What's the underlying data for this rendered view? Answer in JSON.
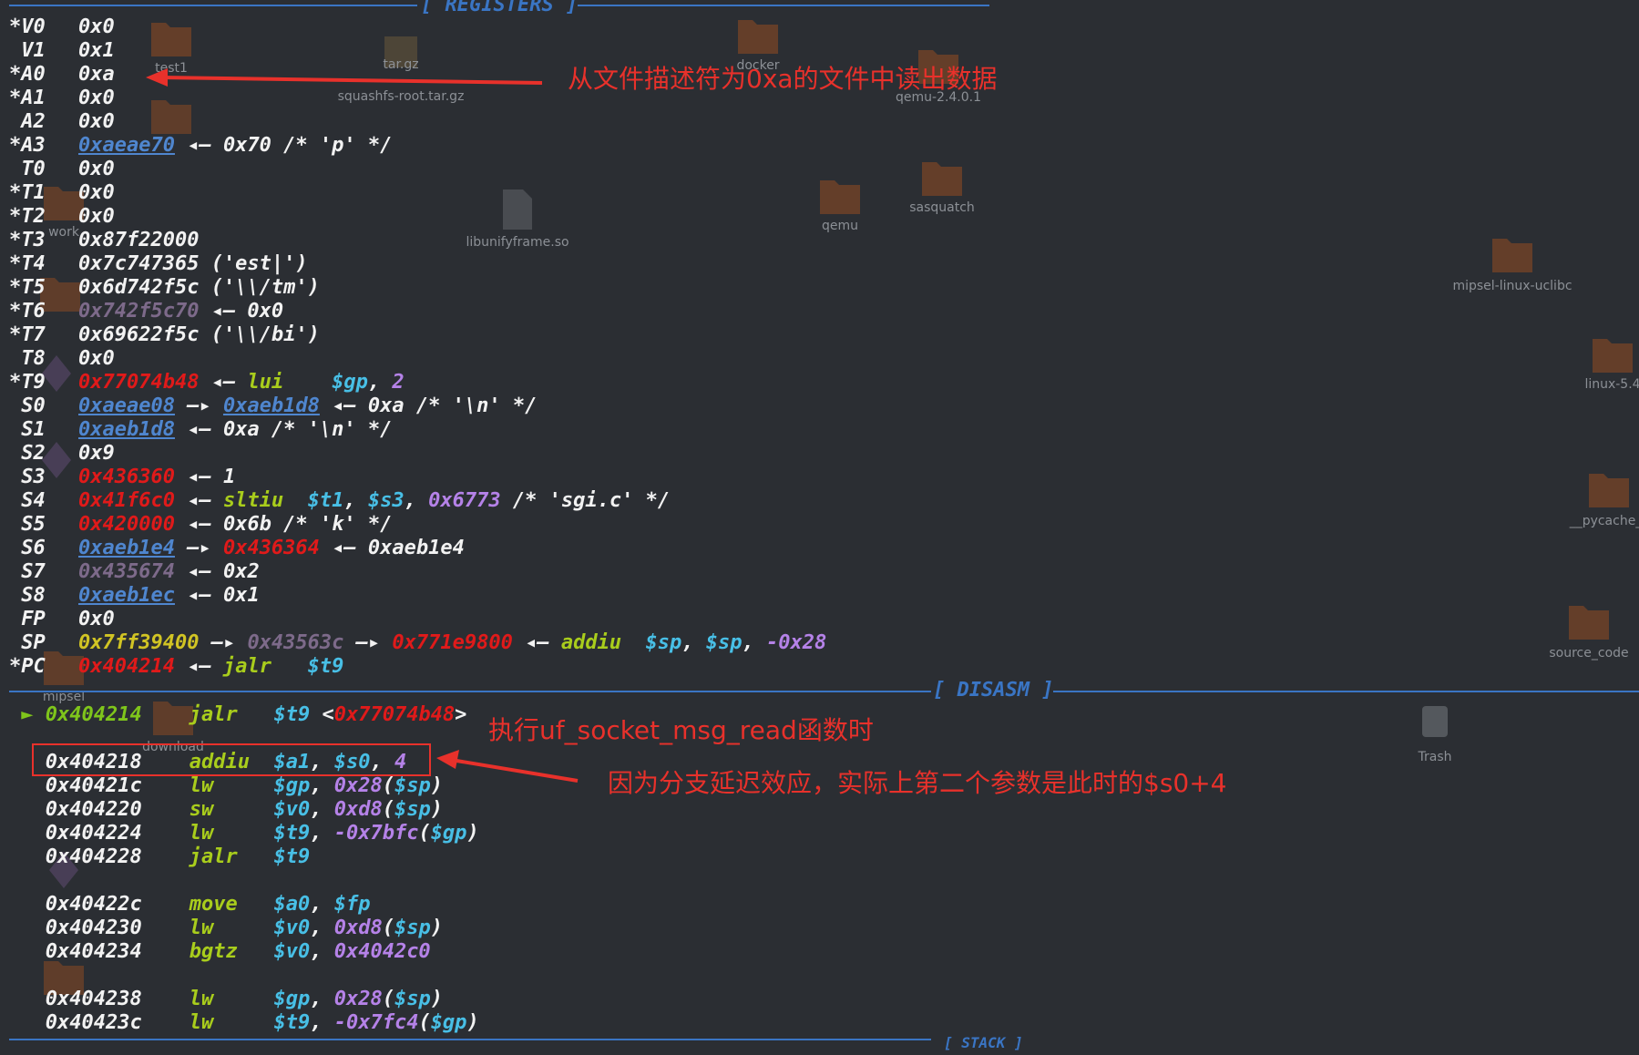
{
  "headers": {
    "registers": "[ REGISTERS ]",
    "disasm": "[ DISASM ]",
    "stack": "[ STACK ]"
  },
  "registers": [
    {
      "name": "*V0",
      "parts": [
        [
          "0x0",
          "w"
        ]
      ]
    },
    {
      "name": " V1",
      "parts": [
        [
          "0x1",
          "w"
        ]
      ]
    },
    {
      "name": "*A0",
      "parts": [
        [
          "0xa",
          "w"
        ]
      ]
    },
    {
      "name": "*A1",
      "parts": [
        [
          "0x0",
          "w"
        ]
      ]
    },
    {
      "name": " A2",
      "parts": [
        [
          "0x0",
          "w"
        ]
      ]
    },
    {
      "name": "*A3",
      "parts": [
        [
          "0xaeae70",
          "bl"
        ],
        [
          " ◂— 0x70 /* 'p' */",
          "w"
        ]
      ]
    },
    {
      "name": " T0",
      "parts": [
        [
          "0x0",
          "w"
        ]
      ]
    },
    {
      "name": "*T1",
      "parts": [
        [
          "0x0",
          "w"
        ]
      ]
    },
    {
      "name": "*T2",
      "parts": [
        [
          "0x0",
          "w"
        ]
      ]
    },
    {
      "name": "*T3",
      "parts": [
        [
          "0x87f22000",
          "w"
        ]
      ]
    },
    {
      "name": "*T4",
      "parts": [
        [
          "0x7c747365 ('est|')",
          "w"
        ]
      ]
    },
    {
      "name": "*T5",
      "parts": [
        [
          "0x6d742f5c ('\\\\/tm')",
          "w"
        ]
      ]
    },
    {
      "name": "*T6",
      "parts": [
        [
          "0x742f5c70",
          "pu"
        ],
        [
          " ◂— 0x0",
          "w"
        ]
      ]
    },
    {
      "name": "*T7",
      "parts": [
        [
          "0x69622f5c ('\\\\/bi')",
          "w"
        ]
      ]
    },
    {
      "name": " T8",
      "parts": [
        [
          "0x0",
          "w"
        ]
      ]
    },
    {
      "name": "*T9",
      "parts": [
        [
          "0x77074b48",
          "rd"
        ],
        [
          " ◂— ",
          "w"
        ],
        [
          "lui    ",
          "gr"
        ],
        [
          "$gp",
          "cy"
        ],
        [
          ", ",
          "w"
        ],
        [
          "2",
          "mg"
        ]
      ]
    },
    {
      "name": " S0",
      "parts": [
        [
          "0xaeae08",
          "bl"
        ],
        [
          " —▸ ",
          "w"
        ],
        [
          "0xaeb1d8",
          "bl"
        ],
        [
          " ◂— 0xa /* '\\n' */",
          "w"
        ]
      ]
    },
    {
      "name": " S1",
      "parts": [
        [
          "0xaeb1d8",
          "bl"
        ],
        [
          " ◂— 0xa /* '\\n' */",
          "w"
        ]
      ]
    },
    {
      "name": " S2",
      "parts": [
        [
          "0x9",
          "w"
        ]
      ]
    },
    {
      "name": " S3",
      "parts": [
        [
          "0x436360",
          "rd"
        ],
        [
          " ◂— 1",
          "w"
        ]
      ]
    },
    {
      "name": " S4",
      "parts": [
        [
          "0x41f6c0",
          "rd"
        ],
        [
          " ◂— ",
          "w"
        ],
        [
          "sltiu  ",
          "gr"
        ],
        [
          "$t1",
          "cy"
        ],
        [
          ", ",
          "w"
        ],
        [
          "$s3",
          "cy"
        ],
        [
          ", ",
          "w"
        ],
        [
          "0x6773",
          "mg"
        ],
        [
          " /* 'sgi.c' */",
          "w"
        ]
      ]
    },
    {
      "name": " S5",
      "parts": [
        [
          "0x420000",
          "rd"
        ],
        [
          " ◂— 0x6b /* 'k' */",
          "w"
        ]
      ]
    },
    {
      "name": " S6",
      "parts": [
        [
          "0xaeb1e4",
          "bl"
        ],
        [
          " —▸ ",
          "w"
        ],
        [
          "0x436364",
          "rd"
        ],
        [
          " ◂— 0xaeb1e4",
          "w"
        ]
      ]
    },
    {
      "name": " S7",
      "parts": [
        [
          "0x435674",
          "pu"
        ],
        [
          " ◂— 0x2",
          "w"
        ]
      ]
    },
    {
      "name": " S8",
      "parts": [
        [
          "0xaeb1ec",
          "bl"
        ],
        [
          " ◂— 0x1",
          "w"
        ]
      ]
    },
    {
      "name": " FP",
      "parts": [
        [
          "0x0",
          "w"
        ]
      ]
    },
    {
      "name": " SP",
      "parts": [
        [
          "0x7ff39400",
          "yl"
        ],
        [
          " —▸ ",
          "w"
        ],
        [
          "0x43563c",
          "pu"
        ],
        [
          " —▸ ",
          "w"
        ],
        [
          "0x771e9800",
          "rd"
        ],
        [
          " ◂— ",
          "w"
        ],
        [
          "addiu  ",
          "gr"
        ],
        [
          "$sp",
          "cy"
        ],
        [
          ", ",
          "w"
        ],
        [
          "$sp",
          "cy"
        ],
        [
          ", ",
          "w"
        ],
        [
          "-0x28",
          "mg"
        ]
      ]
    },
    {
      "name": "*PC",
      "parts": [
        [
          "0x404214",
          "rd"
        ],
        [
          " ◂— ",
          "w"
        ],
        [
          "jalr   ",
          "gr"
        ],
        [
          "$t9",
          "cy"
        ]
      ]
    }
  ],
  "disasm": [
    {
      "gap": 0,
      "marker": " ► ",
      "addr": "0x404214",
      "current": true,
      "parts": [
        [
          "jalr   ",
          "gr"
        ],
        [
          "$t9",
          "cy"
        ],
        [
          " <",
          "w"
        ],
        [
          "0x77074b48",
          "rd"
        ],
        [
          ">",
          "w"
        ]
      ]
    },
    {
      "gap": 1,
      "marker": "   ",
      "addr": "0x404218",
      "parts": [
        [
          "addiu  ",
          "gr"
        ],
        [
          "$a1",
          "cy"
        ],
        [
          ", ",
          "w"
        ],
        [
          "$s0",
          "cy"
        ],
        [
          ", ",
          "w"
        ],
        [
          "4",
          "mg"
        ]
      ]
    },
    {
      "gap": 0,
      "marker": "   ",
      "addr": "0x40421c",
      "parts": [
        [
          "lw     ",
          "gr"
        ],
        [
          "$gp",
          "cy"
        ],
        [
          ", ",
          "w"
        ],
        [
          "0x28",
          "mg"
        ],
        [
          "(",
          "w"
        ],
        [
          "$sp",
          "cy"
        ],
        [
          ")",
          "w"
        ]
      ]
    },
    {
      "gap": 0,
      "marker": "   ",
      "addr": "0x404220",
      "parts": [
        [
          "sw     ",
          "gr"
        ],
        [
          "$v0",
          "cy"
        ],
        [
          ", ",
          "w"
        ],
        [
          "0xd8",
          "mg"
        ],
        [
          "(",
          "w"
        ],
        [
          "$sp",
          "cy"
        ],
        [
          ")",
          "w"
        ]
      ]
    },
    {
      "gap": 0,
      "marker": "   ",
      "addr": "0x404224",
      "parts": [
        [
          "lw     ",
          "gr"
        ],
        [
          "$t9",
          "cy"
        ],
        [
          ", ",
          "w"
        ],
        [
          "-0x7bfc",
          "mg"
        ],
        [
          "(",
          "w"
        ],
        [
          "$gp",
          "cy"
        ],
        [
          ")",
          "w"
        ]
      ]
    },
    {
      "gap": 0,
      "marker": "   ",
      "addr": "0x404228",
      "parts": [
        [
          "jalr   ",
          "gr"
        ],
        [
          "$t9",
          "cy"
        ]
      ]
    },
    {
      "gap": 1,
      "marker": "   ",
      "addr": "0x40422c",
      "parts": [
        [
          "move   ",
          "gr"
        ],
        [
          "$a0",
          "cy"
        ],
        [
          ", ",
          "w"
        ],
        [
          "$fp",
          "cy"
        ]
      ]
    },
    {
      "gap": 0,
      "marker": "   ",
      "addr": "0x404230",
      "parts": [
        [
          "lw     ",
          "gr"
        ],
        [
          "$v0",
          "cy"
        ],
        [
          ", ",
          "w"
        ],
        [
          "0xd8",
          "mg"
        ],
        [
          "(",
          "w"
        ],
        [
          "$sp",
          "cy"
        ],
        [
          ")",
          "w"
        ]
      ]
    },
    {
      "gap": 0,
      "marker": "   ",
      "addr": "0x404234",
      "parts": [
        [
          "bgtz   ",
          "gr"
        ],
        [
          "$v0",
          "cy"
        ],
        [
          ", ",
          "w"
        ],
        [
          "0x4042c0",
          "mg"
        ]
      ]
    },
    {
      "gap": 1,
      "marker": "   ",
      "addr": "0x404238",
      "parts": [
        [
          "lw     ",
          "gr"
        ],
        [
          "$gp",
          "cy"
        ],
        [
          ", ",
          "w"
        ],
        [
          "0x28",
          "mg"
        ],
        [
          "(",
          "w"
        ],
        [
          "$sp",
          "cy"
        ],
        [
          ")",
          "w"
        ]
      ]
    },
    {
      "gap": 0,
      "marker": "   ",
      "addr": "0x40423c",
      "parts": [
        [
          "lw     ",
          "gr"
        ],
        [
          "$t9",
          "cy"
        ],
        [
          ", ",
          "w"
        ],
        [
          "-0x7fc4",
          "mg"
        ],
        [
          "(",
          "w"
        ],
        [
          "$gp",
          "cy"
        ],
        [
          ")",
          "w"
        ]
      ]
    }
  ],
  "annotations": {
    "a0_note": "从文件描述符为0xa的文件中读出数据",
    "call_note": "执行uf_socket_msg_read函数时",
    "delay_note": "因为分支延迟效应，实际上第二个参数是此时的$s0+4"
  },
  "desktop_icons": [
    {
      "label": "test1",
      "icon": "folder-icon"
    },
    {
      "label": "tar.gz",
      "icon": "archive-icon"
    },
    {
      "label": "squashfs-root.tar.gz",
      "icon": "archive-icon"
    },
    {
      "label": "docker",
      "icon": "folder-icon"
    },
    {
      "label": "qemu-2.4.0.1",
      "icon": "folder-icon"
    },
    {
      "label": "sasquatch",
      "icon": "folder-icon"
    },
    {
      "label": "qemu",
      "icon": "folder-icon"
    },
    {
      "label": "libunifyframe.so",
      "icon": "file-icon"
    },
    {
      "label": "mipsel-linux-uclibc",
      "icon": "folder-icon"
    },
    {
      "label": "linux-5.4",
      "icon": "locked-folder-icon"
    },
    {
      "label": "__pycache__",
      "icon": "folder-icon"
    },
    {
      "label": "source_code",
      "icon": "folder-icon"
    },
    {
      "label": "Trash",
      "icon": "trash-icon"
    },
    {
      "label": "download",
      "icon": "folder-icon"
    },
    {
      "label": "mipsel",
      "icon": "folder-icon"
    },
    {
      "label": "work",
      "icon": "folder-icon"
    }
  ]
}
